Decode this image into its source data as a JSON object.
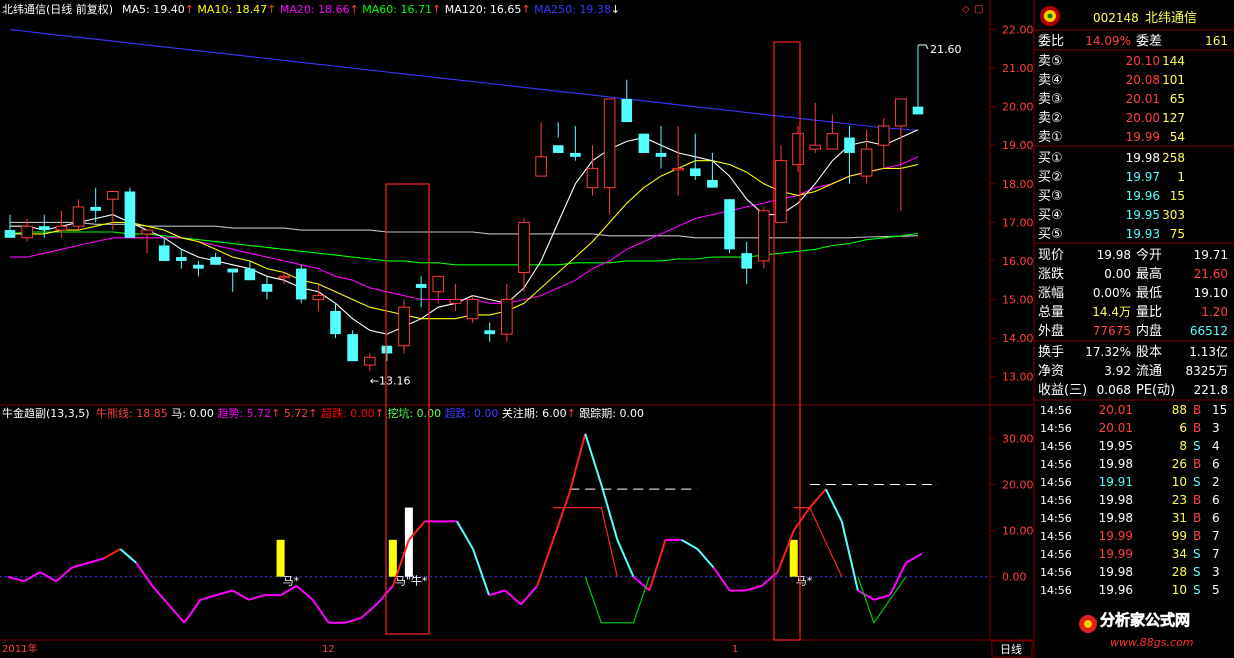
{
  "colors": {
    "bg": "#000000",
    "grid": "#7a0000",
    "up": "#ff3b3b",
    "down": "#54ffff",
    "ma5": "#ffffff",
    "ma10": "#ffff00",
    "ma20": "#ff00ff",
    "ma60": "#00ff00",
    "ma120": "#ffffff",
    "ma250": "#3a3aff",
    "yellowBar": "#ffff00",
    "whiteBar": "#ffffff",
    "label_red": "#ff4040",
    "label_green": "#54ff54",
    "label_cyan": "#54ffff"
  },
  "chart_data": [
    {
      "type": "candlestick",
      "title": "北纬通信(日线 前复权)",
      "legend": [
        {
          "name": "MA5",
          "value": "19.40",
          "arrow": "↑",
          "color": "#ffffff"
        },
        {
          "name": "MA10",
          "value": "18.47",
          "arrow": "↑",
          "color": "#ffff00"
        },
        {
          "name": "MA20",
          "value": "18.66",
          "arrow": "↑",
          "color": "#ff00ff"
        },
        {
          "name": "MA60",
          "value": "16.71",
          "arrow": "↑",
          "color": "#00ff00"
        },
        {
          "name": "MA120",
          "value": "16.65",
          "arrow": "↑",
          "color": "#ffffff"
        },
        {
          "name": "MA250",
          "value": "19.38",
          "arrow": "↓",
          "color": "#3a3aff"
        }
      ],
      "legend_text": [
        "MA5: 19.40",
        "MA10: 18.47",
        "MA20: 18.66",
        "MA60: 16.71",
        "MA120: 16.65",
        "MA250: 19.38"
      ],
      "ylim": [
        12.6,
        22.3
      ],
      "yticks": [
        "22.00",
        "21.00",
        "20.00",
        "19.00",
        "18.00",
        "17.00",
        "16.00",
        "15.00",
        "14.00",
        "13.00"
      ],
      "ytick_values": [
        22,
        21,
        20,
        19,
        18,
        17,
        16,
        15,
        14,
        13
      ],
      "annotations": [
        {
          "text": "←13.16",
          "value": 13.16,
          "index": 21
        },
        {
          "text": "21.60",
          "value": 21.6,
          "index": 53
        }
      ],
      "candles": [
        [
          16.8,
          17.2,
          16.6,
          16.6
        ],
        [
          16.6,
          17.1,
          16.5,
          16.9
        ],
        [
          16.9,
          17.2,
          16.6,
          16.8
        ],
        [
          16.8,
          17.3,
          16.6,
          16.9
        ],
        [
          16.9,
          17.6,
          16.8,
          17.4
        ],
        [
          17.4,
          17.9,
          17.0,
          17.3
        ],
        [
          17.6,
          17.7,
          16.8,
          17.8
        ],
        [
          17.8,
          17.9,
          16.8,
          16.6
        ],
        [
          16.7,
          16.8,
          16.2,
          16.8
        ],
        [
          16.4,
          16.6,
          16.0,
          16.0
        ],
        [
          16.1,
          16.3,
          15.8,
          16.0
        ],
        [
          15.9,
          16.0,
          15.6,
          15.8
        ],
        [
          16.1,
          16.2,
          15.9,
          15.9
        ],
        [
          15.8,
          15.8,
          15.2,
          15.7
        ],
        [
          15.8,
          16.0,
          15.5,
          15.5
        ],
        [
          15.4,
          15.6,
          15.0,
          15.2
        ],
        [
          15.6,
          15.7,
          15.4,
          15.6
        ],
        [
          15.8,
          15.9,
          14.9,
          15.0
        ],
        [
          15.0,
          15.4,
          14.7,
          15.1
        ],
        [
          14.7,
          14.9,
          14.0,
          14.1
        ],
        [
          14.1,
          14.2,
          13.4,
          13.4
        ],
        [
          13.3,
          13.6,
          13.16,
          13.5
        ],
        [
          13.8,
          13.8,
          13.4,
          13.6
        ],
        [
          13.8,
          15.0,
          13.6,
          14.8
        ],
        [
          15.4,
          15.6,
          14.8,
          15.3
        ],
        [
          15.2,
          15.5,
          14.9,
          15.6
        ],
        [
          14.9,
          15.4,
          14.7,
          15.0
        ],
        [
          14.5,
          15.1,
          14.4,
          15.0
        ],
        [
          14.2,
          14.4,
          13.9,
          14.1
        ],
        [
          14.1,
          15.4,
          13.9,
          15.0
        ],
        [
          15.7,
          17.1,
          15.2,
          17.0
        ],
        [
          18.2,
          19.6,
          18.2,
          18.7
        ],
        [
          19.0,
          19.6,
          19.2,
          18.8
        ],
        [
          18.8,
          19.5,
          18.6,
          18.7
        ],
        [
          17.9,
          19.0,
          17.7,
          18.4
        ],
        [
          17.9,
          20.1,
          17.2,
          20.2
        ],
        [
          20.2,
          20.7,
          20.2,
          19.6
        ],
        [
          19.3,
          19.3,
          18.8,
          18.8
        ],
        [
          18.8,
          19.5,
          18.4,
          18.7
        ],
        [
          18.4,
          19.5,
          17.7,
          18.4
        ],
        [
          18.4,
          19.3,
          18.1,
          18.2
        ],
        [
          18.1,
          18.8,
          17.9,
          17.9
        ],
        [
          17.6,
          17.6,
          16.2,
          16.3
        ],
        [
          16.2,
          16.5,
          15.4,
          15.8
        ],
        [
          16.0,
          17.4,
          15.8,
          17.3
        ],
        [
          17.0,
          19.0,
          17.0,
          18.6
        ],
        [
          18.5,
          19.5,
          18.3,
          19.3
        ],
        [
          18.9,
          20.1,
          18.8,
          19.0
        ],
        [
          18.9,
          19.8,
          18.9,
          19.3
        ],
        [
          19.2,
          19.5,
          18.0,
          18.8
        ],
        [
          18.2,
          19.4,
          18.0,
          18.9
        ],
        [
          19.0,
          19.7,
          18.4,
          19.5
        ],
        [
          19.5,
          20.1,
          17.3,
          20.2
        ],
        [
          20.0,
          21.6,
          19.8,
          19.8
        ]
      ],
      "candles_note": "each row is open, high, low, close in price units",
      "ma5": [
        16.9,
        16.9,
        16.8,
        16.9,
        17.0,
        17.1,
        17.2,
        17.0,
        16.8,
        16.6,
        16.3,
        16.1,
        16.0,
        15.9,
        15.8,
        15.6,
        15.5,
        15.3,
        15.2,
        14.9,
        14.5,
        14.2,
        14.1,
        14.3,
        14.5,
        14.8,
        14.9,
        15.1,
        15.0,
        14.9,
        15.3,
        16.0,
        17.0,
        18.0,
        18.6,
        18.9,
        19.1,
        19.2,
        19.0,
        18.8,
        18.7,
        18.6,
        18.2,
        17.6,
        17.2,
        17.2,
        17.5,
        18.0,
        18.6,
        19.0,
        19.1,
        19.0,
        19.2,
        19.4
      ],
      "ma10": [
        16.7,
        16.7,
        16.7,
        16.8,
        16.8,
        16.9,
        17.0,
        17.0,
        16.9,
        16.8,
        16.6,
        16.5,
        16.3,
        16.1,
        16.0,
        15.8,
        15.7,
        15.5,
        15.4,
        15.2,
        15.0,
        14.8,
        14.7,
        14.6,
        14.5,
        14.5,
        14.5,
        14.6,
        14.6,
        14.7,
        14.9,
        15.3,
        15.7,
        16.1,
        16.5,
        17.0,
        17.5,
        17.9,
        18.2,
        18.4,
        18.6,
        18.6,
        18.5,
        18.3,
        18.0,
        17.8,
        17.7,
        17.8,
        18.0,
        18.2,
        18.3,
        18.4,
        18.4,
        18.5
      ],
      "ma20": [
        16.1,
        16.1,
        16.2,
        16.3,
        16.4,
        16.5,
        16.6,
        16.6,
        16.6,
        16.6,
        16.6,
        16.5,
        16.4,
        16.3,
        16.2,
        16.1,
        16.0,
        15.9,
        15.8,
        15.6,
        15.5,
        15.3,
        15.2,
        15.1,
        15.0,
        15.0,
        15.0,
        15.0,
        14.9,
        14.9,
        15.0,
        15.1,
        15.3,
        15.5,
        15.8,
        16.0,
        16.3,
        16.5,
        16.7,
        16.9,
        17.1,
        17.2,
        17.3,
        17.4,
        17.5,
        17.6,
        17.7,
        17.9,
        18.0,
        18.2,
        18.3,
        18.4,
        18.5,
        18.7
      ],
      "ma60": [
        16.7,
        16.75,
        16.75,
        16.75,
        16.75,
        16.75,
        16.75,
        16.7,
        16.7,
        16.65,
        16.6,
        16.55,
        16.5,
        16.45,
        16.4,
        16.35,
        16.3,
        16.25,
        16.2,
        16.15,
        16.1,
        16.05,
        16.0,
        16.0,
        15.95,
        15.95,
        15.9,
        15.9,
        15.9,
        15.9,
        15.9,
        15.9,
        15.9,
        15.95,
        15.95,
        15.95,
        16.0,
        16.0,
        16.0,
        16.05,
        16.05,
        16.1,
        16.1,
        16.1,
        16.15,
        16.2,
        16.25,
        16.3,
        16.4,
        16.45,
        16.55,
        16.6,
        16.65,
        16.71
      ],
      "ma120": [
        17.0,
        17.0,
        17.0,
        17.0,
        17.0,
        16.95,
        16.95,
        16.95,
        16.9,
        16.9,
        16.9,
        16.9,
        16.9,
        16.85,
        16.85,
        16.85,
        16.85,
        16.8,
        16.8,
        16.8,
        16.8,
        16.8,
        16.75,
        16.75,
        16.75,
        16.75,
        16.75,
        16.75,
        16.7,
        16.7,
        16.7,
        16.7,
        16.7,
        16.7,
        16.7,
        16.65,
        16.65,
        16.65,
        16.65,
        16.65,
        16.6,
        16.6,
        16.6,
        16.6,
        16.6,
        16.6,
        16.6,
        16.6,
        16.6,
        16.6,
        16.62,
        16.63,
        16.64,
        16.65
      ],
      "ma250": [
        22.0,
        21.95,
        21.9,
        21.85,
        21.8,
        21.75,
        21.7,
        21.65,
        21.6,
        21.55,
        21.5,
        21.45,
        21.4,
        21.35,
        21.3,
        21.25,
        21.2,
        21.15,
        21.1,
        21.05,
        21.0,
        20.95,
        20.9,
        20.85,
        20.8,
        20.75,
        20.7,
        20.65,
        20.6,
        20.55,
        20.5,
        20.45,
        20.4,
        20.35,
        20.3,
        20.25,
        20.2,
        20.15,
        20.1,
        20.05,
        20.0,
        19.95,
        19.9,
        19.85,
        19.8,
        19.75,
        19.7,
        19.65,
        19.6,
        19.55,
        19.5,
        19.45,
        19.42,
        19.38
      ]
    },
    {
      "type": "line",
      "title": "牛金趋副(13,3,5)",
      "legend": [
        {
          "name": "牛熊线",
          "value": "18.85",
          "color": "#ff4040"
        },
        {
          "name": "马",
          "value": "0.00",
          "color": "#ffffff"
        },
        {
          "name": "趋势",
          "value": "5.72",
          "arrow": "↑",
          "color": "#ff00ff"
        },
        {
          "name": "",
          "value": "5.72",
          "arrow": "↑",
          "color": "#ff4040"
        },
        {
          "name": "超跌",
          "value": "0.00",
          "arrow": "↑",
          "color": "#ff0000"
        },
        {
          "name": "挖坑",
          "value": "0.00",
          "color": "#54ff54"
        },
        {
          "name": "超跌",
          "value": "0.00",
          "color": "#3a3aff"
        },
        {
          "name": "关注期",
          "value": "6.00",
          "arrow": "↑",
          "color": "#ffffff"
        },
        {
          "name": "跟踪期",
          "value": "0.00",
          "color": "#ffffff"
        }
      ],
      "legend_text": [
        "牛熊线: 18.85",
        "马: 0.00",
        "趋势: 5.72",
        "5.72",
        "超跌: 0.00",
        "挖坑: 0.00",
        "超跌: 0.00",
        "关注期: 6.00",
        "跟踪期: 0.00"
      ],
      "ylim": [
        -12,
        34
      ],
      "yticks": [
        "30.00",
        "20.00",
        "10.00",
        "0.00"
      ],
      "ytick_values": [
        30,
        20,
        10,
        0
      ],
      "trend": [
        0,
        -1,
        1,
        -1,
        2,
        3,
        4,
        6,
        3,
        -2,
        -6,
        -10,
        -5,
        -4,
        -3,
        -5,
        -4,
        -4,
        -2,
        -5,
        -10,
        -10,
        -9,
        -6,
        -2,
        8,
        12,
        12,
        12,
        6,
        -4,
        -3,
        -6,
        -2,
        8,
        18,
        31,
        20,
        8,
        0,
        -3,
        8,
        8,
        6,
        2,
        -3,
        -3,
        -2,
        1,
        10,
        15,
        19,
        12,
        -3,
        -5,
        -4,
        3,
        5
      ],
      "bars": [
        {
          "index": 17,
          "height": 8,
          "color": "#ffff00"
        },
        {
          "index": 24,
          "height": 8,
          "color": "#ffff00"
        },
        {
          "index": 25,
          "height": 15,
          "color": "#ffffff"
        },
        {
          "index": 49,
          "height": 8,
          "color": "#ffff00"
        }
      ],
      "ma_labels": [
        {
          "text": "马*",
          "index": 17
        },
        {
          "text": "马\"牛*",
          "index": 24
        },
        {
          "text": "马*",
          "index": 49
        }
      ],
      "dashes": [
        {
          "value": 19,
          "from": 35,
          "to": 43
        },
        {
          "value": 20,
          "from": 50,
          "to": 58
        }
      ]
    }
  ],
  "x_labels": [
    "2011年",
    "12",
    "1"
  ],
  "period_label": "日线",
  "quote": {
    "code": "002148",
    "name": "北纬通信",
    "weibi_label": "委比",
    "weibi": "14.09%",
    "weicha_label": "委差",
    "weicha": "161",
    "asks": [
      {
        "label": "卖⑤",
        "price": "20.10",
        "vol": "144"
      },
      {
        "label": "卖④",
        "price": "20.08",
        "vol": "101"
      },
      {
        "label": "卖③",
        "price": "20.01",
        "vol": "65"
      },
      {
        "label": "卖②",
        "price": "20.00",
        "vol": "127"
      },
      {
        "label": "卖①",
        "price": "19.99",
        "vol": "54"
      }
    ],
    "bids": [
      {
        "label": "买①",
        "price": "19.98",
        "vol": "258"
      },
      {
        "label": "买②",
        "price": "19.97",
        "vol": "1"
      },
      {
        "label": "买③",
        "price": "19.96",
        "vol": "15"
      },
      {
        "label": "买④",
        "price": "19.95",
        "vol": "303"
      },
      {
        "label": "买⑤",
        "price": "19.93",
        "vol": "75"
      }
    ],
    "stats": [
      {
        "l1": "现价",
        "v1": "19.98",
        "c1": "#ffffff",
        "l2": "今开",
        "v2": "19.71",
        "c2": "#ffffff"
      },
      {
        "l1": "涨跌",
        "v1": "0.00",
        "c1": "#ffffff",
        "l2": "最高",
        "v2": "21.60",
        "c2": "#ff4040"
      },
      {
        "l1": "涨幅",
        "v1": "0.00%",
        "c1": "#ffffff",
        "l2": "最低",
        "v2": "19.10",
        "c2": "#ffffff"
      },
      {
        "l1": "总量",
        "v1": "14.4万",
        "c1": "#ffff54",
        "l2": "量比",
        "v2": "1.20",
        "c2": "#ff4040"
      },
      {
        "l1": "外盘",
        "v1": "77675",
        "c1": "#ff4040",
        "l2": "内盘",
        "v2": "66512",
        "c2": "#54ffff"
      }
    ],
    "stats2": [
      {
        "l1": "换手",
        "v1": "17.32%",
        "l2": "股本",
        "v2": "1.13亿"
      },
      {
        "l1": "净资",
        "v1": "3.92",
        "l2": "流通",
        "v2": "8325万"
      },
      {
        "l1": "收益(三)",
        "v1": "0.068",
        "l2": "PE(动)",
        "v2": "221.8"
      }
    ],
    "ticks": [
      {
        "time": "14:56",
        "price": "20.01",
        "pc": "#ff4040",
        "vol": "88",
        "bs": "B",
        "n": "15"
      },
      {
        "time": "14:56",
        "price": "20.01",
        "pc": "#ff4040",
        "vol": "6",
        "bs": "B",
        "n": "3"
      },
      {
        "time": "14:56",
        "price": "19.95",
        "pc": "#ffffff",
        "vol": "8",
        "bs": "S",
        "n": "4"
      },
      {
        "time": "14:56",
        "price": "19.98",
        "pc": "#ffffff",
        "vol": "26",
        "bs": "B",
        "n": "6"
      },
      {
        "time": "14:56",
        "price": "19.91",
        "pc": "#54ffff",
        "vol": "10",
        "bs": "S",
        "n": "2"
      },
      {
        "time": "14:56",
        "price": "19.98",
        "pc": "#ffffff",
        "vol": "23",
        "bs": "B",
        "n": "6"
      },
      {
        "time": "14:56",
        "price": "19.98",
        "pc": "#ffffff",
        "vol": "31",
        "bs": "B",
        "n": "6"
      },
      {
        "time": "14:56",
        "price": "19.99",
        "pc": "#ff4040",
        "vol": "99",
        "bs": "B",
        "n": "7"
      },
      {
        "time": "14:56",
        "price": "19.99",
        "pc": "#ff4040",
        "vol": "34",
        "bs": "S",
        "n": "7"
      },
      {
        "time": "14:56",
        "price": "19.98",
        "pc": "#ffffff",
        "vol": "28",
        "bs": "S",
        "n": "3"
      },
      {
        "time": "14:56",
        "price": "19.96",
        "pc": "#ffffff",
        "vol": "10",
        "bs": "S",
        "n": "5"
      }
    ]
  },
  "watermark": {
    "text": "分析家公式网",
    "url": "www.88gs.com"
  }
}
